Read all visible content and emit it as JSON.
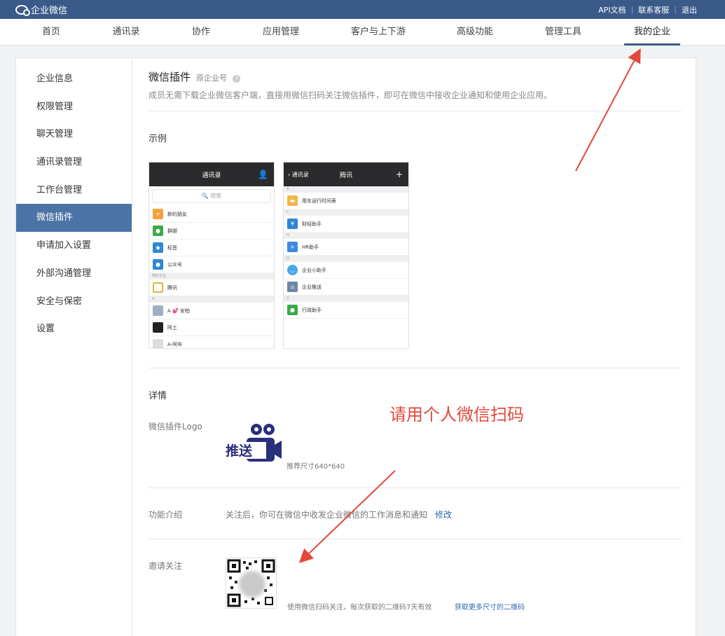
{
  "topbar": {
    "brand": "企业微信",
    "links": [
      "API文档",
      "联系客服",
      "退出"
    ]
  },
  "nav": {
    "items": [
      "首页",
      "通讯录",
      "协作",
      "应用管理",
      "客户与上下游",
      "高级功能",
      "管理工具",
      "我的企业"
    ],
    "active": "我的企业"
  },
  "sidebar": {
    "items": [
      "企业信息",
      "权限管理",
      "聊天管理",
      "通讯录管理",
      "工作台管理",
      "微信插件",
      "申请加入设置",
      "外部沟通管理",
      "安全与保密",
      "设置"
    ],
    "active": "微信插件"
  },
  "section": {
    "title": "微信插件",
    "subtitle": "原企业号",
    "description": "成员无需下载企业微信客户端，直接用微信扫码关注微信插件，即可在微信中接收企业通知和使用企业应用。"
  },
  "example": {
    "title": "示例",
    "phone1": {
      "title": "通讯录",
      "search": "搜索",
      "rows": [
        "新的朋友",
        "群聊",
        "标签",
        "公众号"
      ],
      "section_my_company": "我的企业",
      "company": "腾讯",
      "section_a": "A",
      "contacts": [
        "A 💕 安柏",
        "阿土",
        "A-阿布"
      ]
    },
    "phone2": {
      "back": "通讯录",
      "title": "腾讯",
      "plus": "+",
      "section_a": "A",
      "section_c": "C",
      "section_h": "H",
      "section_q": "Q",
      "section_x": "X",
      "rows": [
        "用车运行时间表",
        "财经助手",
        "HR助手",
        "企业小助手",
        "企业推送",
        "行政助手"
      ]
    }
  },
  "detail": {
    "title": "详情",
    "logo_label": "微信插件Logo",
    "logo_text": "推送",
    "logo_note": "推荐尺寸640*640",
    "intro_label": "功能介绍",
    "intro_text": "关注后，你可在微信中收发企业微信的工作消息和通知",
    "intro_link": "修改",
    "invite_label": "邀请关注",
    "qr_note": "使用微信扫码关注，每次获取的二维码7天有效",
    "qr_link": "获取更多尺寸的二维码"
  },
  "annotation": {
    "text": "请用个人微信扫码",
    "color": "#e2483d"
  }
}
